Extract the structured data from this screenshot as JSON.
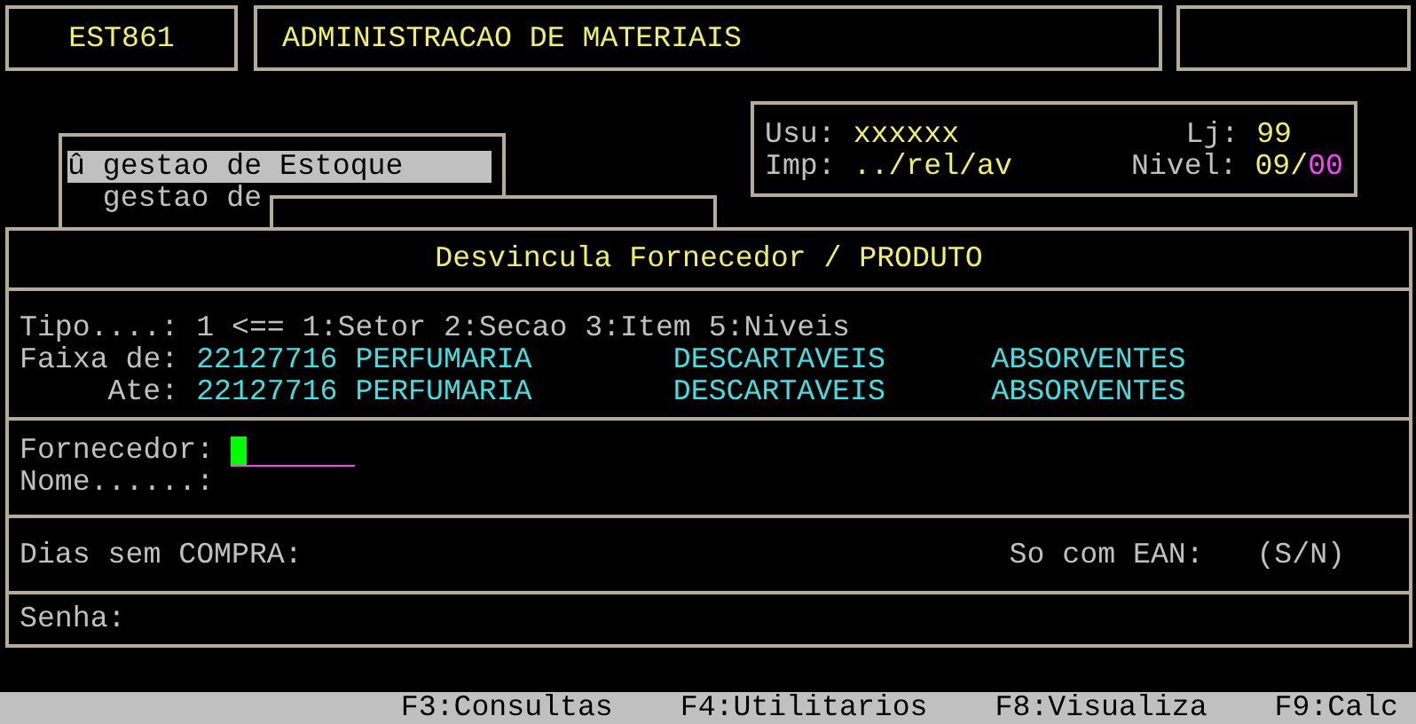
{
  "header": {
    "program_code": "EST861",
    "system_title": "ADMINISTRACAO DE MATERIAIS"
  },
  "menu": {
    "items": [
      {
        "marker": "û",
        "label": "gestao de Estoque",
        "selected": true
      },
      {
        "label": "gestao de",
        "selected": false
      }
    ]
  },
  "session": {
    "user_label": "Usu:",
    "user": "xxxxxx",
    "store_label": "Lj:",
    "store": "99",
    "printer_label": "Imp:",
    "printer": "../rel/av",
    "level_label": "Nivel:",
    "level_value": "09/",
    "level_sub": "00"
  },
  "form": {
    "title": "Desvincula Fornecedor / PRODUTO",
    "tipo": {
      "label": "Tipo....:",
      "value": "1",
      "hint": "<== 1:Setor 2:Secao 3:Item 5:Niveis"
    },
    "ranges": [
      {
        "label": "Faixa de:",
        "code": "22127716",
        "level_1": "PERFUMARIA",
        "level_2": "DESCARTAVEIS",
        "level_3": "ABSORVENTES"
      },
      {
        "label": "Ate:",
        "code": "22127716",
        "level_1": "PERFUMARIA",
        "level_2": "DESCARTAVEIS",
        "level_3": "ABSORVENTES"
      }
    ],
    "fornecedor": {
      "label": "Fornecedor:"
    },
    "nome": {
      "label": "Nome......:"
    },
    "dias": {
      "label": "Dias sem COMPRA:"
    },
    "ean": {
      "label": "So com EAN:",
      "hint": "(S/N)"
    },
    "senha": {
      "label": "Senha:"
    }
  },
  "function_keys": [
    "F3:Consultas",
    "F4:Utilitarios",
    "F8:Visualiza",
    "F9:Calc"
  ]
}
